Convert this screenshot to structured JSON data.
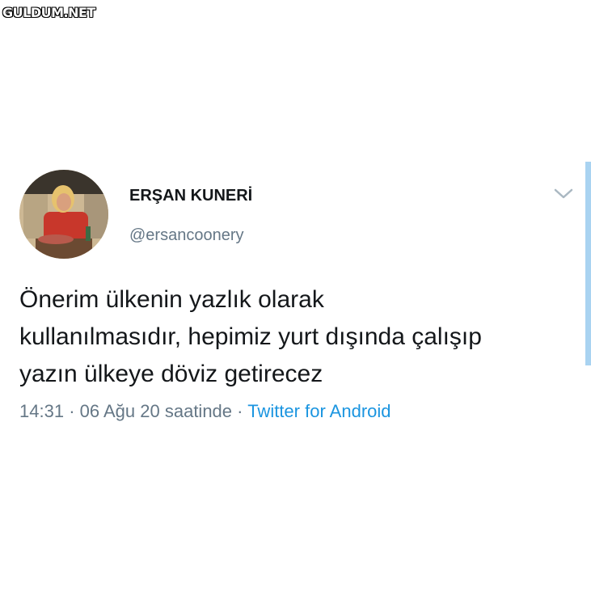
{
  "watermark": {
    "text": "GULDUM.NET"
  },
  "tweet": {
    "display_name": "ERŞAN KUNERİ",
    "handle": "@ersancoonery",
    "text_lines": [
      "Önerim ülkenin yazlık olarak",
      "kullanılmasıdır, hepimiz yurt dışında çalışıp",
      "yazın ülkeye döviz getirecez"
    ],
    "time": "14:31",
    "date": "06 Ağu 20 saatinde",
    "separator": "·",
    "source": "Twitter for Android"
  },
  "icons": {
    "menu": "chevron-down-icon"
  },
  "colors": {
    "text": "#14171a",
    "secondary": "#657786",
    "link": "#1b95e0",
    "scrollbar": "#a9d3f1"
  }
}
